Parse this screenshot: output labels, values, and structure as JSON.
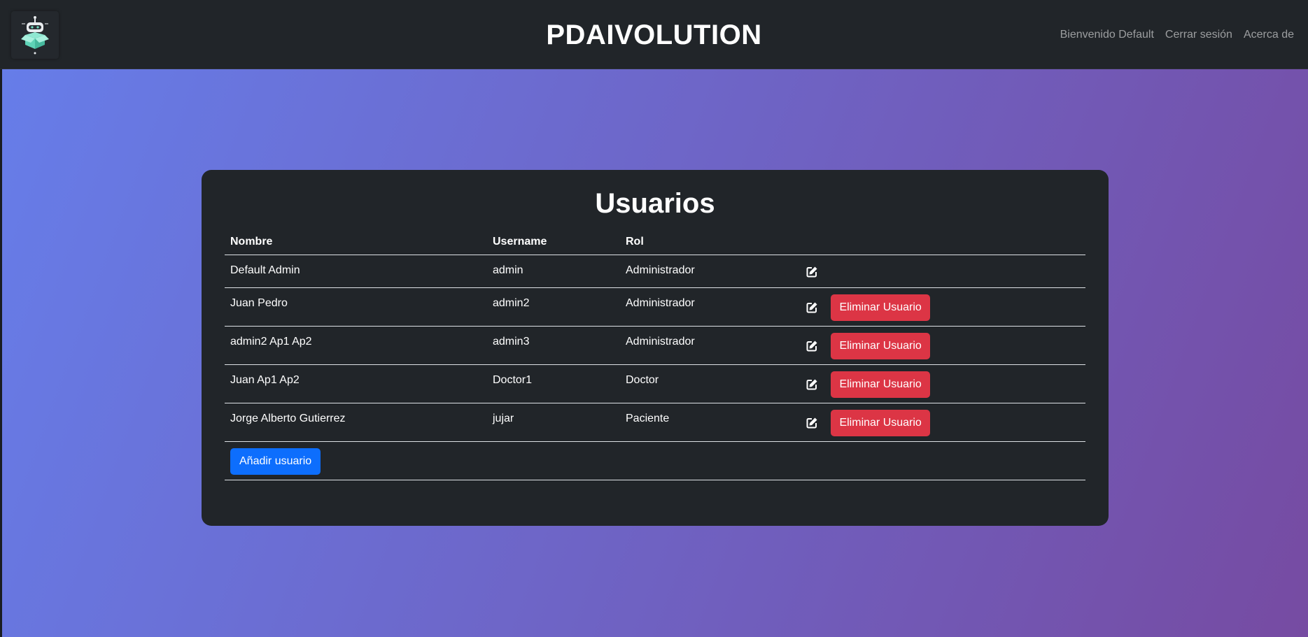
{
  "navbar": {
    "brand": "PDAIVOLUTION",
    "links": [
      "Bienvenido Default",
      "Cerrar sesión",
      "Acerca de"
    ],
    "logo_icon": "robot-box-logo"
  },
  "card": {
    "title": "Usuarios",
    "columns": [
      "Nombre",
      "Username",
      "Rol",
      ""
    ],
    "rows": [
      {
        "nombre": "Default Admin",
        "username": "admin",
        "rol": "Administrador",
        "can_delete": false
      },
      {
        "nombre": "Juan Pedro",
        "username": "admin2",
        "rol": "Administrador",
        "can_delete": true
      },
      {
        "nombre": "admin2 Ap1 Ap2",
        "username": "admin3",
        "rol": "Administrador",
        "can_delete": true
      },
      {
        "nombre": "Juan Ap1 Ap2",
        "username": "Doctor1",
        "rol": "Doctor",
        "can_delete": true
      },
      {
        "nombre": "Jorge Alberto Gutierrez",
        "username": "jujar",
        "rol": "Paciente",
        "can_delete": true
      }
    ],
    "delete_label": "Eliminar Usuario",
    "add_label": "Añadir usuario",
    "edit_icon": "edit-icon"
  },
  "colors": {
    "navbar_bg": "#212529",
    "gradient_start": "#667eea",
    "gradient_end": "#764ba2",
    "danger": "#dc3545",
    "primary": "#0d6efd"
  }
}
